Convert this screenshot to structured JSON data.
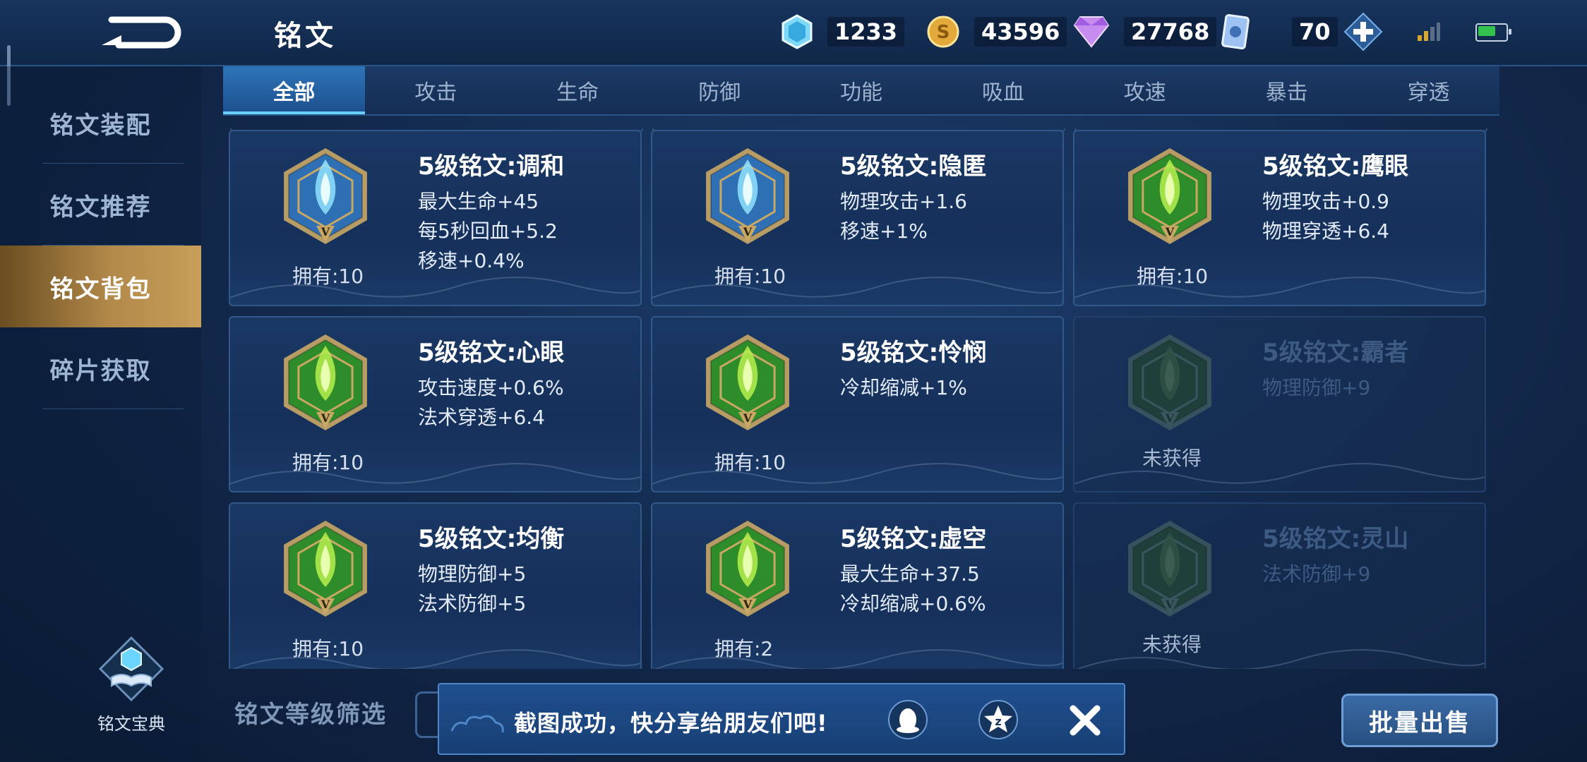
{
  "header": {
    "title": "铭文",
    "currencies": [
      {
        "icon": "crystal-icon",
        "value": "1233"
      },
      {
        "icon": "gold-coin-icon",
        "value": "43596"
      },
      {
        "icon": "diamond-icon",
        "value": "27768"
      },
      {
        "icon": "inscription-card-icon",
        "value": "70"
      }
    ],
    "add_icon": "plus-icon"
  },
  "sidebar": {
    "items": [
      {
        "label": "铭文装配",
        "active": false
      },
      {
        "label": "铭文推荐",
        "active": false
      },
      {
        "label": "铭文背包",
        "active": true
      },
      {
        "label": "碎片获取",
        "active": false
      }
    ],
    "codex_label": "铭文宝典"
  },
  "tabs": [
    "全部",
    "攻击",
    "生命",
    "防御",
    "功能",
    "吸血",
    "攻速",
    "暴击",
    "穿透"
  ],
  "active_tab": "全部",
  "cards": [
    {
      "name": "5级铭文:调和",
      "stats": [
        "最大生命+45",
        "每5秒回血+5.2",
        "移速+0.4%"
      ],
      "owned": "拥有:10",
      "locked": false,
      "color": "blue",
      "icon": "drop-icon"
    },
    {
      "name": "5级铭文:隐匿",
      "stats": [
        "物理攻击+1.6",
        "移速+1%"
      ],
      "owned": "拥有:10",
      "locked": false,
      "color": "blue",
      "icon": "flame-icon"
    },
    {
      "name": "5级铭文:鹰眼",
      "stats": [
        "物理攻击+0.9",
        "物理穿透+6.4"
      ],
      "owned": "拥有:10",
      "locked": false,
      "color": "green",
      "icon": "eagle-icon"
    },
    {
      "name": "5级铭文:心眼",
      "stats": [
        "攻击速度+0.6%",
        "法术穿透+6.4"
      ],
      "owned": "拥有:10",
      "locked": false,
      "color": "green",
      "icon": "eye-icon"
    },
    {
      "name": "5级铭文:怜悯",
      "stats": [
        "冷却缩减+1%"
      ],
      "owned": "拥有:10",
      "locked": false,
      "color": "green",
      "icon": "hourglass-icon"
    },
    {
      "name": "5级铭文:霸者",
      "stats": [
        "物理防御+9"
      ],
      "owned": "未获得",
      "locked": true,
      "color": "dim",
      "icon": "shield-icon"
    },
    {
      "name": "5级铭文:均衡",
      "stats": [
        "物理防御+5",
        "法术防御+5"
      ],
      "owned": "拥有:10",
      "locked": false,
      "color": "green",
      "icon": "balance-icon"
    },
    {
      "name": "5级铭文:虚空",
      "stats": [
        "最大生命+37.5",
        "冷却缩减+0.6%"
      ],
      "owned": "拥有:2",
      "locked": false,
      "color": "green",
      "icon": "void-icon"
    },
    {
      "name": "5级铭文:灵山",
      "stats": [
        "法术防御+9"
      ],
      "owned": "未获得",
      "locked": true,
      "color": "dim",
      "icon": "mountain-icon"
    }
  ],
  "badge_level": "V",
  "filter_label": "铭文等级筛选",
  "toast": {
    "text": "截图成功，快分享给朋友们吧!",
    "share_icons": [
      "qq-icon",
      "qzone-icon"
    ],
    "close_icon": "close-icon"
  },
  "sell_button": "批量出售"
}
